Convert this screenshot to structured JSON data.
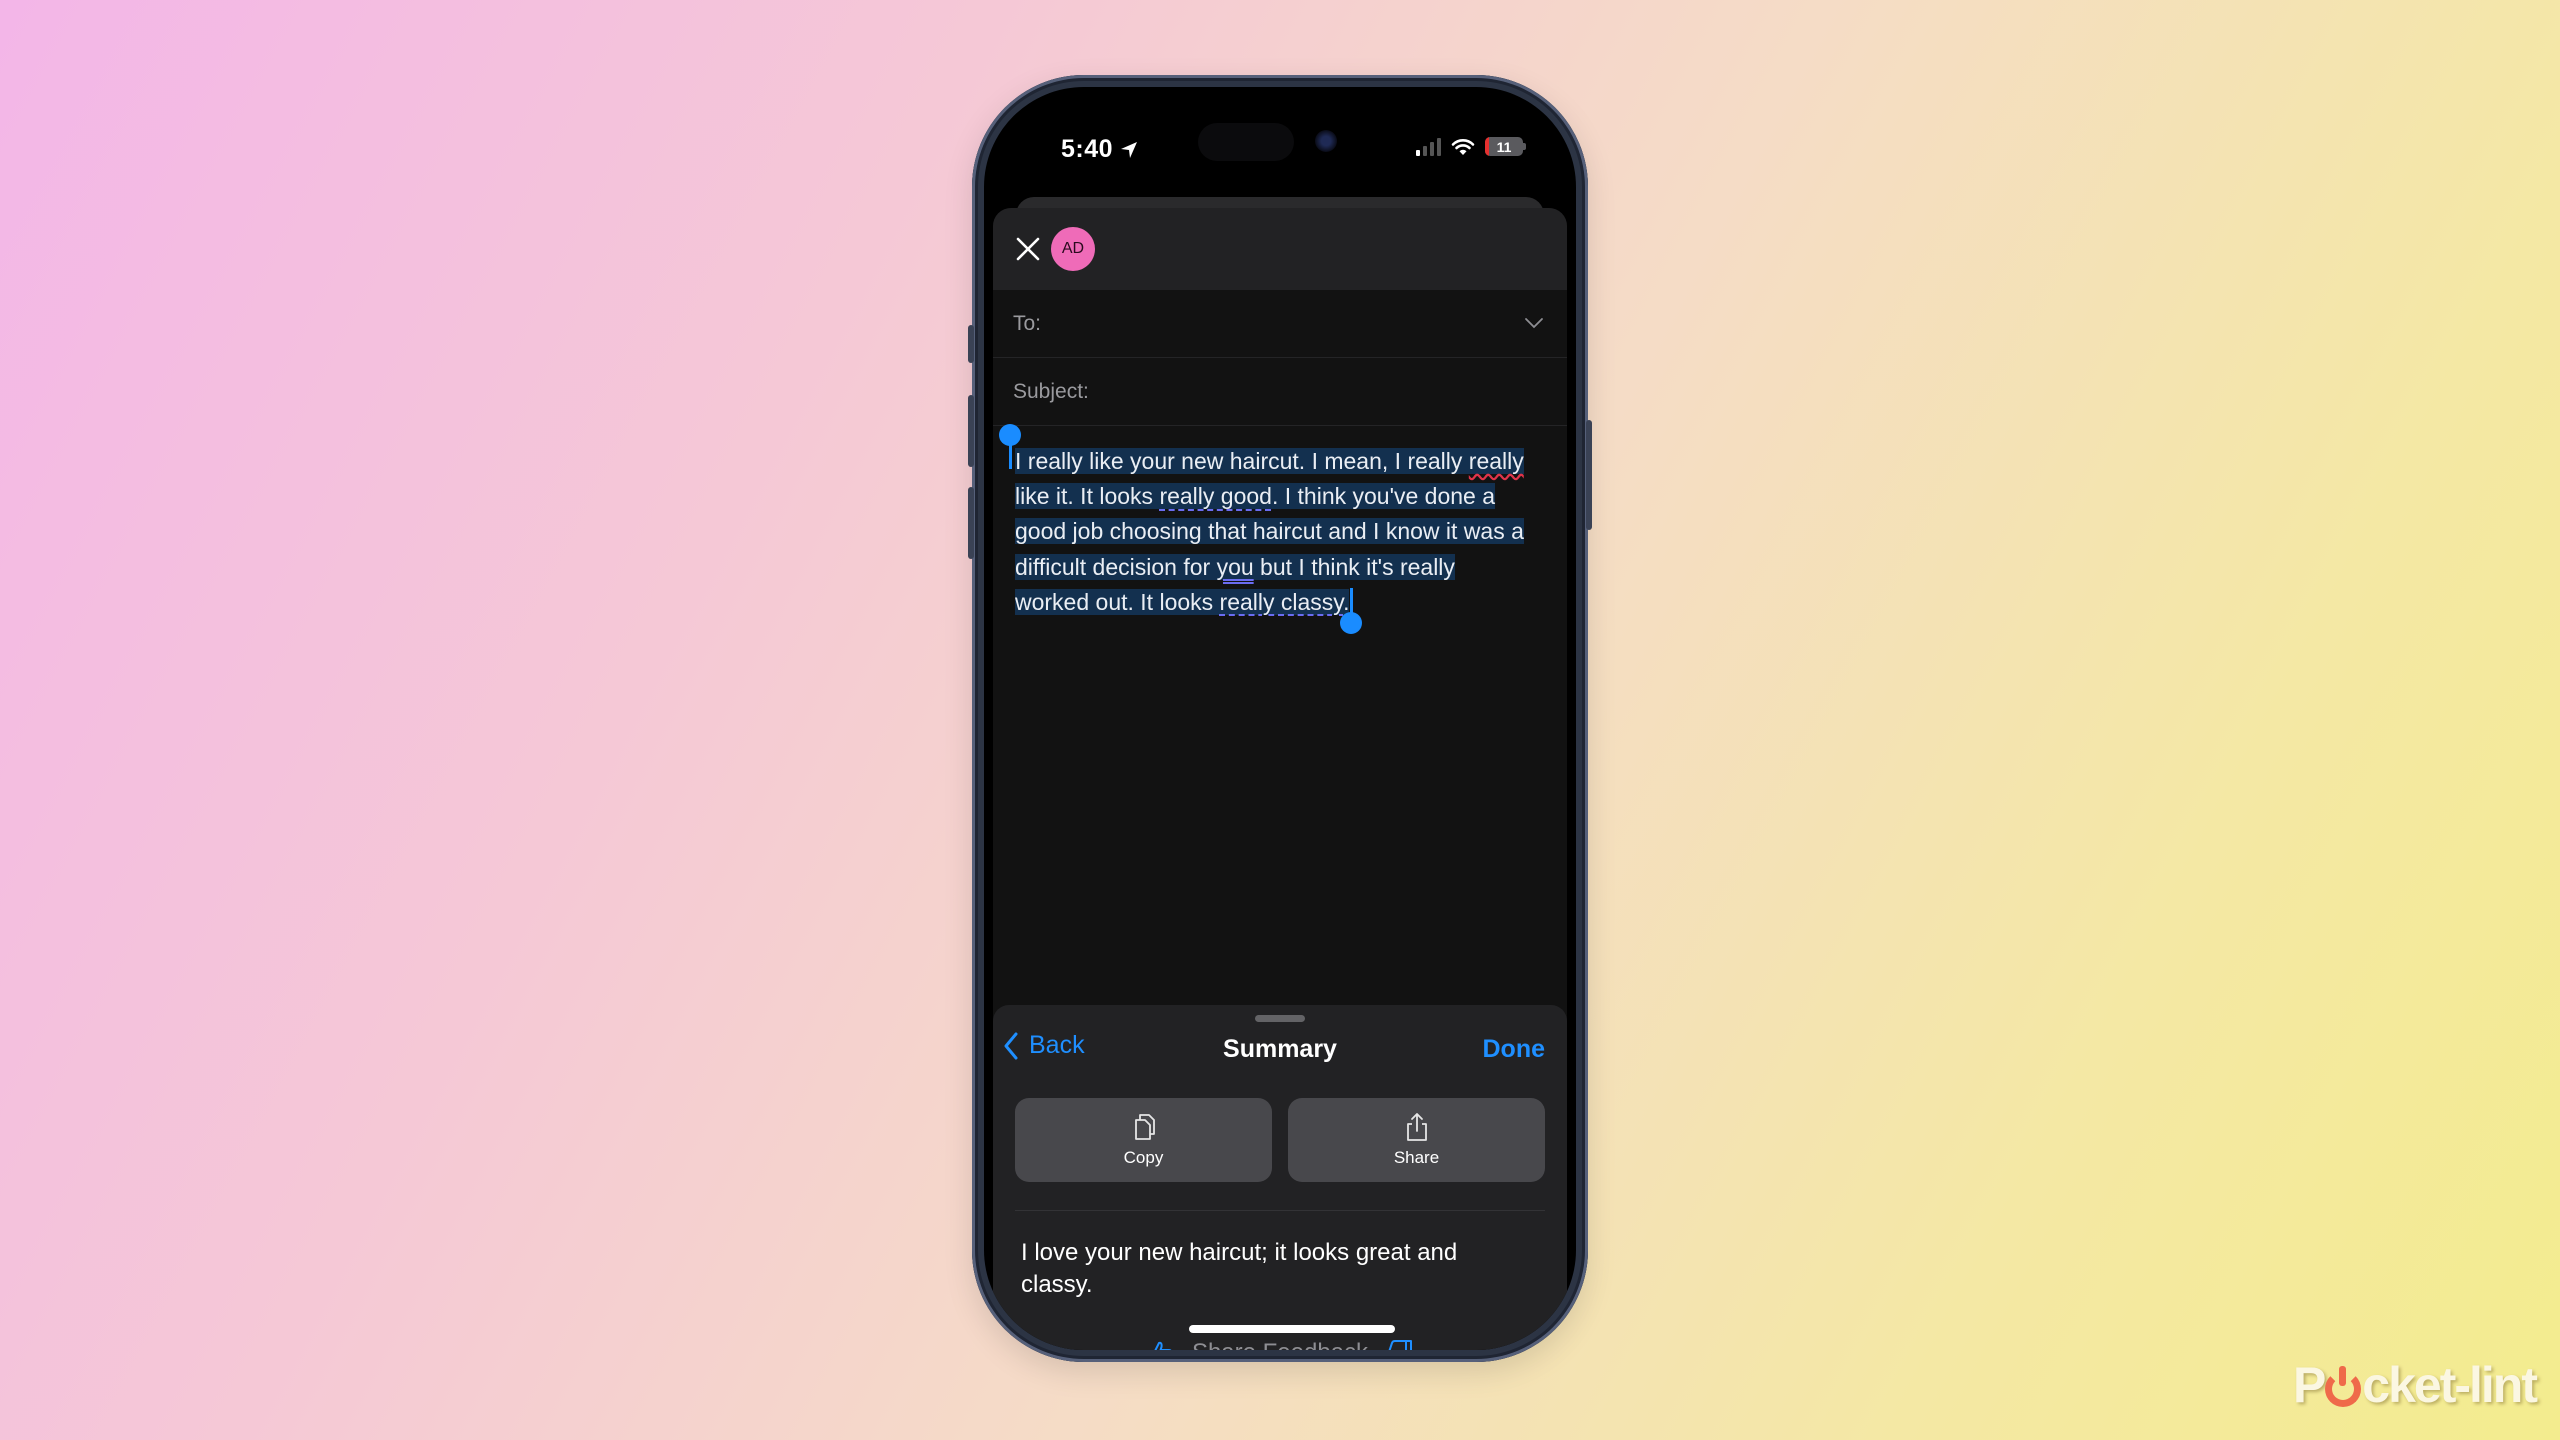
{
  "status_bar": {
    "time": "5:40",
    "location_icon": "location-arrow-icon",
    "signal_bars_on": 1,
    "signal_bars_total": 4,
    "wifi_icon": "wifi-icon",
    "battery_level": "11",
    "battery_color": "#e5302f"
  },
  "compose": {
    "avatar_initials": "AD",
    "avatar_color": "#ef6bb8",
    "to_label": "To:",
    "to_value": "",
    "subject_label": "Subject:",
    "subject_value": "",
    "body": {
      "line1_a": "I really like your new haircut. I mean, I really ",
      "line1_b": "really",
      "line2_a": "like it. It looks ",
      "line2_b": "really good",
      "line2_c": ". I think you've done a",
      "line3": "good job choosing that haircut and I know it was a",
      "line4_a": "difficult decision for ",
      "line4_b": "you",
      "line4_c": " but I think it's really",
      "line5_a": "worked out. It looks ",
      "line5_b": "really classy",
      "line5_c": "."
    },
    "selection_color": "#13304f",
    "handle_color": "#1a8cff"
  },
  "summary_panel": {
    "back_label": "Back",
    "title": "Summary",
    "done_label": "Done",
    "accent_color": "#1f8fff",
    "actions": [
      {
        "label": "Copy",
        "icon": "copy-icon"
      },
      {
        "label": "Share",
        "icon": "share-icon"
      }
    ],
    "summary_text": "I love your new haircut; it looks great and classy.",
    "feedback_label": "Share Feedback"
  },
  "watermark": {
    "pre": "P",
    "post": "cket-lint"
  }
}
